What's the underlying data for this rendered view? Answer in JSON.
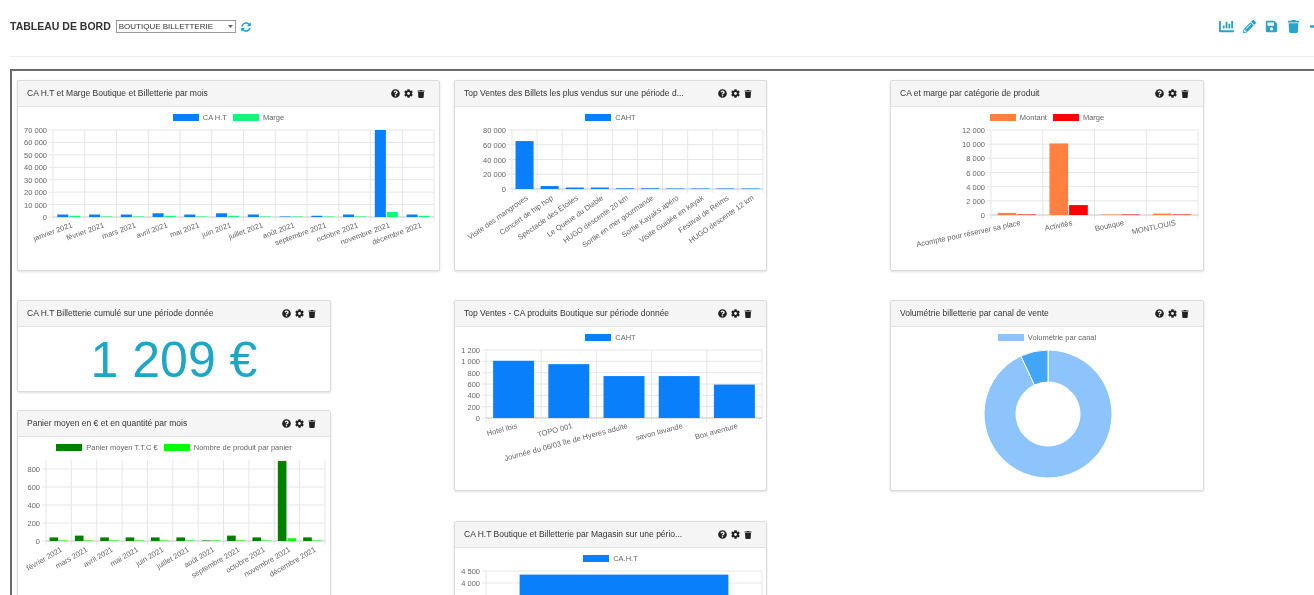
{
  "header": {
    "title": "TABLEAU DE BORD",
    "select": {
      "value": "BOUTIQUE BILLETTERIE"
    }
  },
  "columns": [
    {
      "widgets": [
        {
          "kind": "chart",
          "title": "CA H.T et Marge Boutique et Billetterie par mois",
          "chart_data": {
            "type": "bar",
            "grid": true,
            "legend": true,
            "categories": [
              "janvier 2021",
              "février 2021",
              "mars 2021",
              "avril 2021",
              "mai 2021",
              "juin 2021",
              "juillet 2021",
              "août 2021",
              "septembre 2021",
              "octobre 2021",
              "novembre 2021",
              "décembre 2021"
            ],
            "series": [
              {
                "name": "CA H.T",
                "color": "#0a7ffb",
                "values": [
                  2000,
                  2000,
                  2000,
                  3000,
                  2000,
                  3000,
                  2000,
                  0,
                  1000,
                  2000,
                  70000,
                  2000
                ]
              },
              {
                "name": "Marge",
                "color": "#14f57a",
                "values": [
                  1000,
                  0,
                  0,
                  1000,
                  0,
                  1000,
                  0,
                  0,
                  0,
                  0,
                  4000,
                  1000
                ]
              }
            ],
            "ylim": [
              0,
              70000
            ],
            "yticks": [
              {
                "value": 0,
                "label": "0"
              },
              {
                "value": 10000,
                "label": "10 000"
              },
              {
                "value": 20000,
                "label": "20 000"
              },
              {
                "value": 30000,
                "label": "30 000"
              },
              {
                "value": 40000,
                "label": "40 000"
              },
              {
                "value": 50000,
                "label": "50 000"
              },
              {
                "value": 60000,
                "label": "60 000"
              },
              {
                "value": 70000,
                "label": "70 000"
              }
            ]
          }
        },
        {
          "kind": "number",
          "title": "CA H.T Billetterie cumulé sur une période donnée",
          "value": "1 209 €"
        },
        {
          "kind": "chart",
          "title": "Panier moyen en € et en quantité par mois",
          "chart_data": {
            "type": "bar",
            "grid": true,
            "legend": true,
            "categories": [
              "février 2021",
              "mars 2021",
              "avril 2021",
              "mai 2021",
              "juin 2021",
              "juillet 2021",
              "août 2021",
              "septembre 2021",
              "octobre 2021",
              "novembre 2021",
              "décembre 2021"
            ],
            "series": [
              {
                "name": "Panier moyen T.T.C €",
                "color": "#008000",
                "values": [
                  40,
                  60,
                  40,
                  40,
                  40,
                  40,
                  0,
                  60,
                  40,
                  890,
                  40
                ]
              },
              {
                "name": "Nombre de produit par panier",
                "color": "#00ff00",
                "values": [
                  0,
                  0,
                  0,
                  0,
                  0,
                  0,
                  0,
                  0,
                  0,
                  30,
                  0
                ]
              }
            ],
            "ylim": [
              0,
              900
            ],
            "yticks": [
              0,
              200,
              400,
              600,
              800
            ]
          }
        }
      ]
    },
    {
      "widgets": [
        {
          "kind": "chart",
          "title": "Top Ventes des Billets les plus vendus sur une période d...",
          "chart_data": {
            "type": "bar",
            "grid": true,
            "legend": true,
            "categories": [
              "Visite des mangroves",
              "Concert de hip hop",
              "Spectacle des Etoiles",
              "Le Queue du Diable",
              "HUGO descente 20 km",
              "Sortie en mer gourmande",
              "Sortie Kayaks apéro",
              "Visite Guidée en kayak",
              "Festival de Reims",
              "HUGO descente 12 km"
            ],
            "series": [
              {
                "name": "CAHT",
                "color": "#0a7ffb",
                "values": [
                  65000,
                  4000,
                  2000,
                  2000,
                  1000,
                  1000,
                  0,
                  0,
                  0,
                  0
                ]
              }
            ],
            "ylim": [
              0,
              80000
            ],
            "yticks": [
              {
                "value": 0,
                "label": "0"
              },
              {
                "value": 20000,
                "label": "20 000"
              },
              {
                "value": 40000,
                "label": "40 000"
              },
              {
                "value": 60000,
                "label": "60 000"
              },
              {
                "value": 80000,
                "label": "80 000"
              }
            ]
          }
        },
        {
          "kind": "chart",
          "title": "Top Ventes - CA produits Boutique sur période donnée",
          "chart_data": {
            "type": "bar",
            "grid": true,
            "legend": true,
            "categories": [
              "Hotel Ibis",
              "TOPO 001",
              "Journée du 06/03 île de Hyeres adulte",
              "savon lavande",
              "Box aventure"
            ],
            "series": [
              {
                "name": "CAHT",
                "color": "#0a7ffb",
                "values": [
                  1010,
                  950,
                  740,
                  740,
                  590
                ]
              }
            ],
            "ylim": [
              0,
              1200
            ],
            "yticks": [
              {
                "value": 0,
                "label": "0"
              },
              {
                "value": 200,
                "label": "200"
              },
              {
                "value": 400,
                "label": "400"
              },
              {
                "value": 600,
                "label": "600"
              },
              {
                "value": 800,
                "label": "800"
              },
              {
                "value": 1000,
                "label": "1 000"
              },
              {
                "value": 1200,
                "label": "1 200"
              }
            ]
          }
        },
        {
          "kind": "chart",
          "title": "CA H.T Boutique et Billetterie par Magasin sur une pério...",
          "chart_data": {
            "type": "bar",
            "grid": true,
            "legend": true,
            "series": [
              {
                "name": "CA.H.T",
                "color": "#0a7ffb",
                "values": [
                  4350
                ]
              }
            ],
            "ylim": [
              0,
              4500
            ],
            "yticks": [
              {
                "value": 4000,
                "label": "4 000"
              },
              {
                "value": 4500,
                "label": "4 500"
              }
            ]
          }
        }
      ]
    },
    {
      "widgets": [
        {
          "kind": "chart",
          "title": "CA et marge par catégorie de produit",
          "chart_data": {
            "type": "bar",
            "grid": true,
            "legend": true,
            "categories": [
              "Acompte pour réserver sa place",
              "Activités",
              "Boutique",
              "MONTLOUIS"
            ],
            "series": [
              {
                "name": "Montant",
                "color": "#ff8040",
                "values": [
                  300,
                  10100,
                  0,
                  200
                ]
              },
              {
                "name": "Marge",
                "color": "#ff0000",
                "values": [
                  0,
                  1400,
                  0,
                  0
                ]
              }
            ],
            "ylim": [
              0,
              12000
            ],
            "yticks": [
              {
                "value": 0,
                "label": "0"
              },
              {
                "value": 2000,
                "label": "2 000"
              },
              {
                "value": 4000,
                "label": "4 000"
              },
              {
                "value": 6000,
                "label": "6 000"
              },
              {
                "value": 8000,
                "label": "8 000"
              },
              {
                "value": 10000,
                "label": "10 000"
              },
              {
                "value": 12000,
                "label": "12 000"
              }
            ]
          }
        },
        {
          "kind": "donut",
          "title": "Volumétrie billetterie par canal de vente",
          "legend": [
            {
              "name": "Volumétrie par canal",
              "color": "#8cc4fb"
            }
          ]
        }
      ]
    }
  ]
}
